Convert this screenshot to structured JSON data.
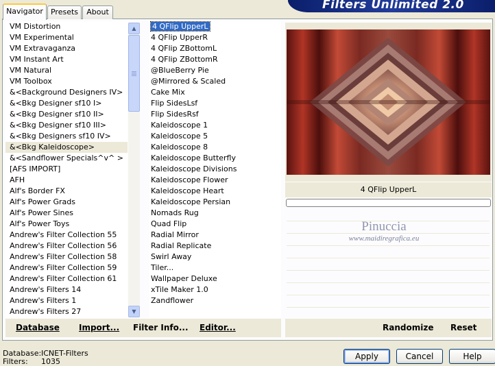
{
  "tabs": [
    "Navigator",
    "Presets",
    "About"
  ],
  "banner_title": "Filters Unlimited 2.0",
  "categories": [
    "VM Distortion",
    "VM Experimental",
    "VM Extravaganza",
    "VM Instant Art",
    "VM Natural",
    "VM Toolbox",
    "&<Background Designers IV>",
    "&<Bkg Designer sf10 I>",
    "&<Bkg Designer sf10 II>",
    "&<Bkg Designer sf10 III>",
    "&<Bkg Designers sf10 IV>",
    "&<Bkg Kaleidoscope>",
    "&<Sandflower Specials^v^ >",
    "[AFS IMPORT]",
    "AFH",
    "Alf's Border FX",
    "Alf's Power Grads",
    "Alf's Power Sines",
    "Alf's Power Toys",
    "Andrew's Filter Collection 55",
    "Andrew's Filter Collection 56",
    "Andrew's Filter Collection 58",
    "Andrew's Filter Collection 59",
    "Andrew's Filter Collection 61",
    "Andrew's Filters 14",
    "Andrew's Filters 1",
    "Andrew's Filters 27"
  ],
  "selected_category": "&<Bkg Kaleidoscope>",
  "filters": [
    "4 QFlip UpperL",
    "4 QFlip UpperR",
    "4 QFlip ZBottomL",
    "4 QFlip ZBottomR",
    "@BlueBerry Pie",
    "@Mirrored & Scaled",
    "Cake Mix",
    "Flip SidesLsf",
    "Flip SidesRsf",
    "Kaleidoscope 1",
    "Kaleidoscope 5",
    "Kaleidoscope 8",
    "Kaleidoscope Butterfly",
    "Kaleidoscope Divisions",
    "Kaleidoscope Flower",
    "Kaleidoscope Heart",
    "Kaleidoscope Persian",
    "Nomads Rug",
    "Quad Flip",
    "Radial Mirror",
    "Radial Replicate",
    "Swirl Away",
    "Tiler...",
    "Wallpaper Deluxe",
    "xTile Maker 1.0",
    "Zandflower"
  ],
  "selected_filter": "4 QFlip UpperL",
  "preview_filter_name": "4 QFlip UpperL",
  "progress": 0,
  "watermark": {
    "line1": "Pinuccia",
    "line2": "www.maidiregrafica.eu"
  },
  "links_left": {
    "database": "Database",
    "import": "Import...",
    "filter_info": "Filter Info...",
    "editor": "Editor..."
  },
  "links_right": {
    "randomize": "Randomize",
    "reset": "Reset"
  },
  "status": {
    "database_label": "Database:",
    "database_value": "ICNET-Filters",
    "filters_label": "Filters:",
    "filters_value": "1035"
  },
  "buttons": {
    "apply": "Apply",
    "cancel": "Cancel",
    "help": "Help"
  },
  "colors": {
    "selection": "#316ac5",
    "banner": "#0a1e6a",
    "dialog_bg": "#ece9d8"
  }
}
